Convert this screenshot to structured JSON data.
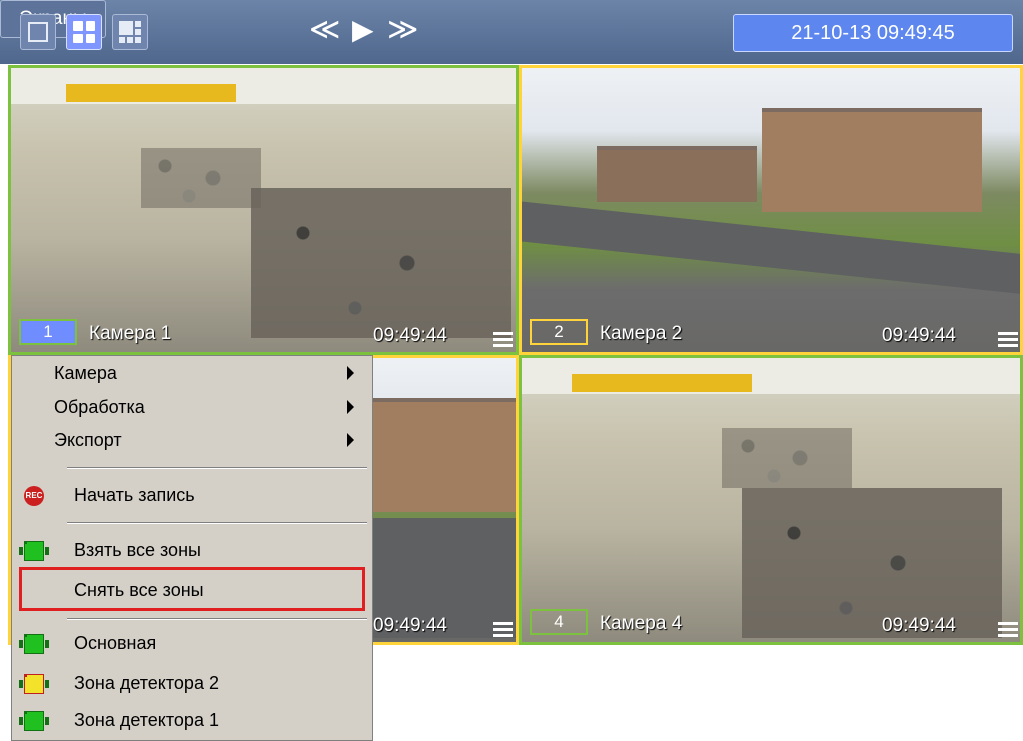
{
  "toolbar": {
    "layout_buttons": [
      "layout-1",
      "layout-4",
      "layout-9"
    ],
    "active_layout": "layout-4",
    "screens_label": "Экраны",
    "prev_label": "≪",
    "play_label": "▶",
    "next_label": "≫",
    "datetime": "21-10-13  09:49:45",
    "colors": {
      "bar": "#5c7399",
      "active": "#7f96ff",
      "datetime_bg": "#5d86ee"
    }
  },
  "cameras": [
    {
      "number": "1",
      "name": "Камера 1",
      "time": "09:49:44",
      "border_color": "#7dc23e",
      "badge_bg": "#6f8dff"
    },
    {
      "number": "2",
      "name": "Камера 2",
      "time": "09:49:44",
      "border_color": "#ffd43a",
      "badge_bg": ""
    },
    {
      "number": "",
      "name": "",
      "time": "09:49:44",
      "border_color": "#ffd43a",
      "badge_bg": ""
    },
    {
      "number": "4",
      "name": "Камера 4",
      "time": "09:49:44",
      "border_color": "#7dc23e",
      "badge_bg": ""
    }
  ],
  "context_menu": {
    "camera": "Камера",
    "processing": "Обработка",
    "export": "Экспорт",
    "start_recording": "Начать запись",
    "rec_icon_text": "REC",
    "arm_all_zones": "Взять все зоны",
    "disarm_all_zones": "Снять все зоны",
    "zones": [
      {
        "label": "Основная",
        "icon": "zone-armed-icon"
      },
      {
        "label": "Зона детектора 2",
        "icon": "zone-alarm-icon"
      },
      {
        "label": "Зона детектора 1",
        "icon": "zone-armed-icon"
      }
    ],
    "highlighted_item": "Снять все зоны",
    "highlight_color": "#e02020"
  }
}
